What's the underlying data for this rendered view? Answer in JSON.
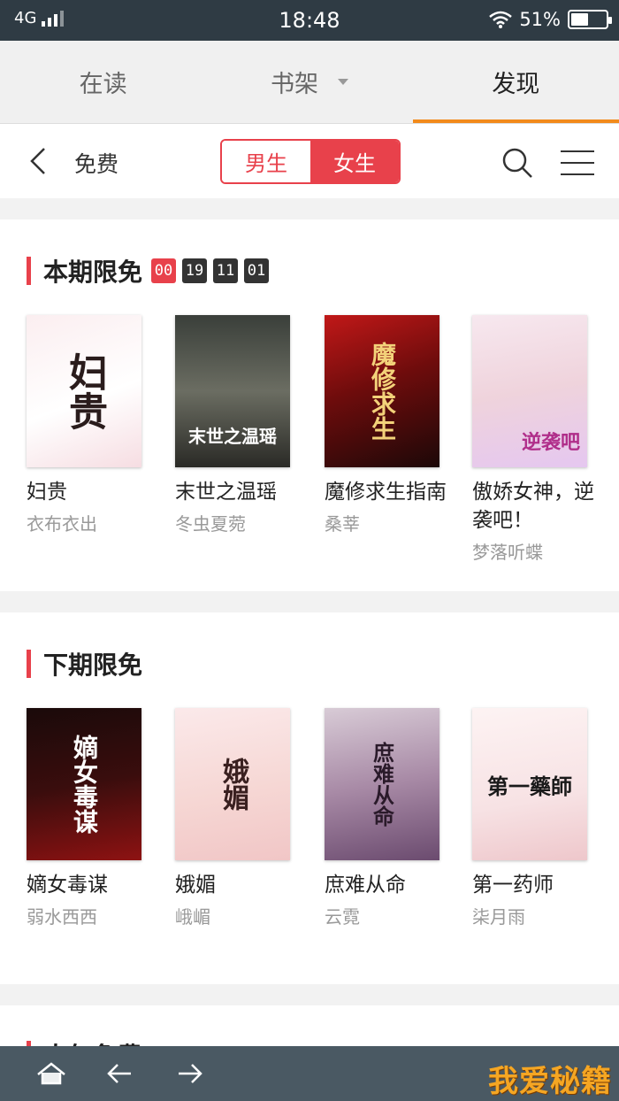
{
  "status_bar": {
    "network": "4G",
    "time": "18:48",
    "battery_percent": "51%",
    "battery_level": 0.51
  },
  "top_tabs": [
    {
      "label": "在读"
    },
    {
      "label": "书架"
    },
    {
      "label": "发现"
    }
  ],
  "active_top_tab": "发现",
  "sub_header": {
    "title": "免费",
    "gender_male": "男生",
    "gender_female": "女生",
    "selected_gender": "女生"
  },
  "current_free": {
    "title": "本期限免",
    "countdown": [
      "00",
      "19",
      "11",
      "01"
    ],
    "books": [
      {
        "title": "妇贵",
        "author": "衣布衣出",
        "cover_text": "妇贵"
      },
      {
        "title": "末世之温瑶",
        "author": "冬虫夏菀",
        "cover_text": "末世之温瑶"
      },
      {
        "title": "魔修求生指南",
        "author": "桑莘",
        "cover_text": "魔修求生"
      },
      {
        "title": "傲娇女神，逆袭吧！",
        "author": "梦落听蝶",
        "cover_text": "逆袭吧"
      }
    ]
  },
  "next_free": {
    "title": "下期限免",
    "books": [
      {
        "title": "嫡女毒谋",
        "author": "弱水西西",
        "cover_text": "嫡女毒谋"
      },
      {
        "title": "娥媚",
        "author": "峨嵋",
        "cover_text": "娥媚"
      },
      {
        "title": "庶难从命",
        "author": "云霓",
        "cover_text": "庶难从命"
      },
      {
        "title": "第一药师",
        "author": "柒月雨",
        "cover_text": "第一藥師"
      }
    ]
  },
  "peek_section": {
    "title": "人气免费"
  },
  "watermark": "我爱秘籍",
  "colors": {
    "accent_red": "#e8414b",
    "tab_indicator": "#f28a1b",
    "status_bar": "#2f3b44",
    "bottom_bar": "#4a5963"
  }
}
